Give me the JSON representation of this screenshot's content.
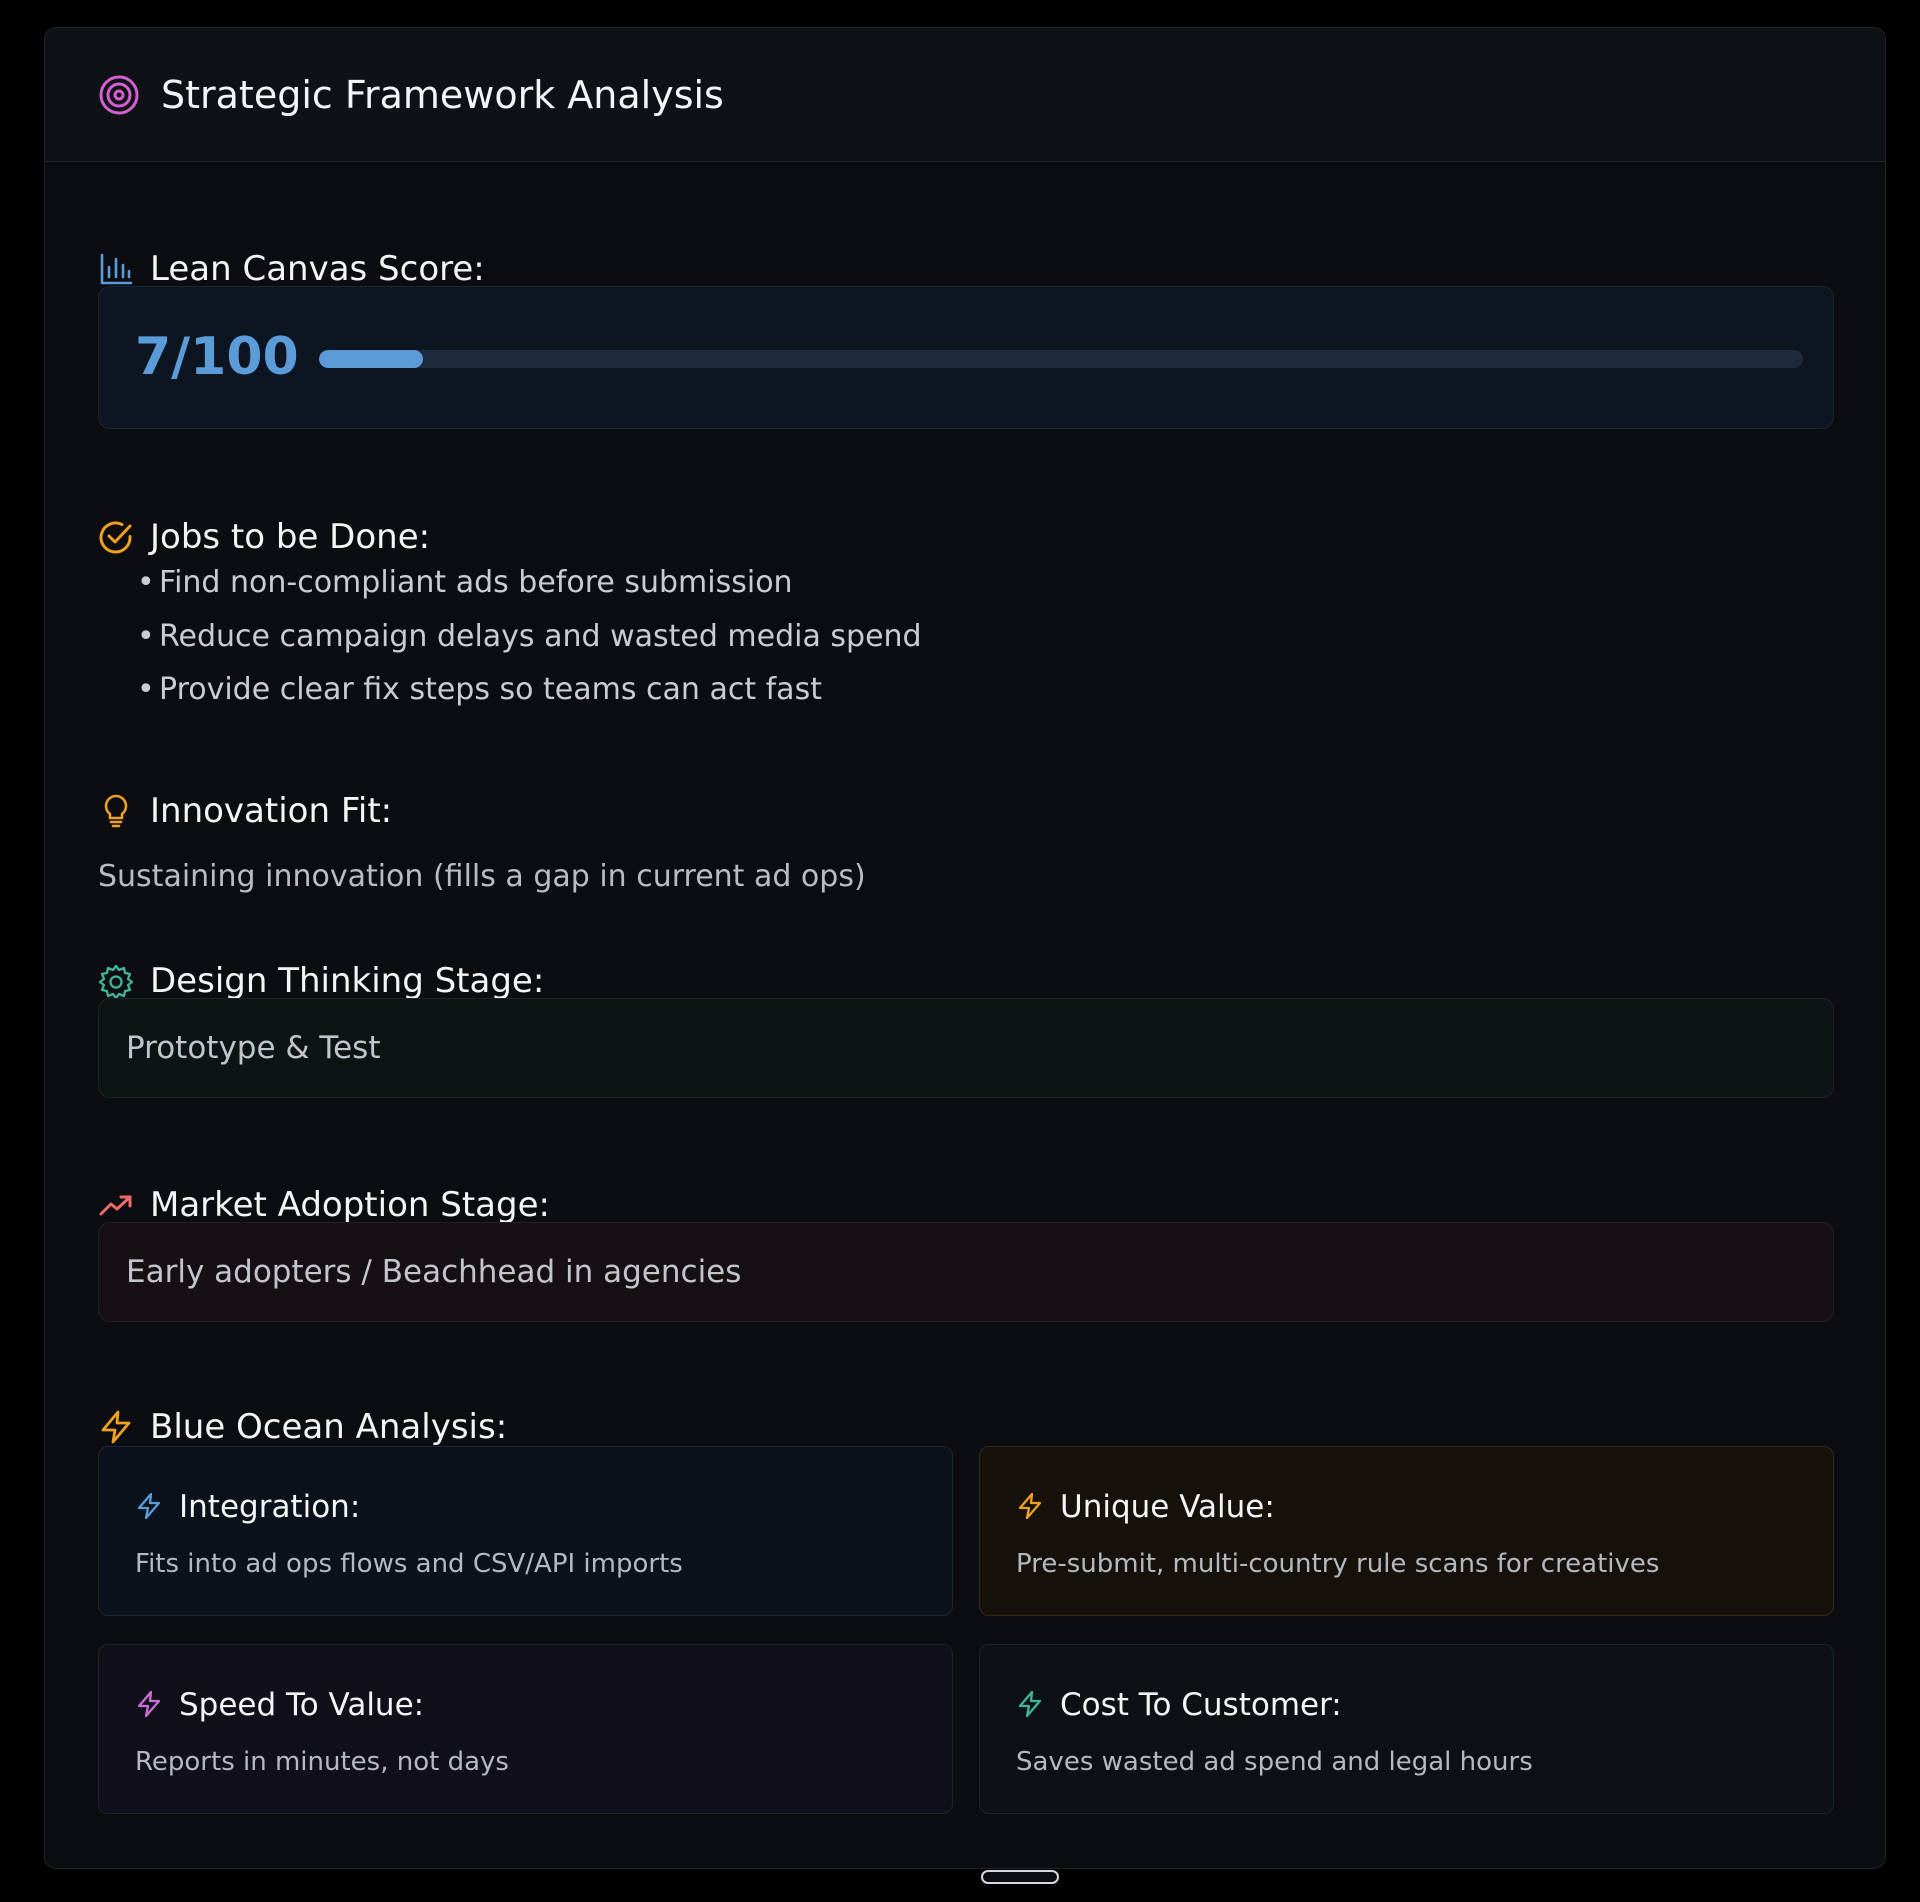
{
  "header": {
    "title": "Strategic Framework Analysis",
    "icon": "target-icon",
    "icon_color": "#d35fd0"
  },
  "lean_canvas": {
    "heading": "Lean Canvas Score:",
    "icon": "bar-chart-icon",
    "icon_color": "#5b9bd8",
    "score_text": "7/100",
    "score_fraction": 0.07
  },
  "jobs": {
    "heading": "Jobs to be Done:",
    "icon": "check-circle-icon",
    "icon_color": "#f0a020",
    "items": [
      "Find non-compliant ads before submission",
      "Reduce campaign delays and wasted media spend",
      "Provide clear fix steps so teams can act fast"
    ]
  },
  "innovation": {
    "heading": "Innovation Fit:",
    "icon": "lightbulb-icon",
    "icon_color": "#f0a020",
    "text": "Sustaining innovation (fills a gap in current ad ops)"
  },
  "design_thinking": {
    "heading": "Design Thinking Stage:",
    "icon": "gear-icon",
    "icon_color": "#3fb59a",
    "value": "Prototype & Test"
  },
  "market_adoption": {
    "heading": "Market Adoption Stage:",
    "icon": "trending-up-icon",
    "icon_color": "#ef6b6b",
    "value": "Early adopters / Beachhead in agencies"
  },
  "blue_ocean": {
    "heading": "Blue Ocean Analysis:",
    "icon": "lightning-icon",
    "icon_color": "#f0a020",
    "cards": [
      {
        "title": "Integration:",
        "desc": "Fits into ad ops flows and CSV/API imports",
        "icon": "lightning-icon",
        "icon_color": "#5b9bd8"
      },
      {
        "title": "Unique Value:",
        "desc": "Pre-submit, multi-country rule scans for creatives",
        "icon": "lightning-icon",
        "icon_color": "#f0a020"
      },
      {
        "title": "Speed To Value:",
        "desc": "Reports in minutes, not days",
        "icon": "lightning-icon",
        "icon_color": "#c86fd6"
      },
      {
        "title": "Cost To Customer:",
        "desc": "Saves wasted ad spend and legal hours",
        "icon": "lightning-icon",
        "icon_color": "#3fb59a"
      }
    ]
  }
}
